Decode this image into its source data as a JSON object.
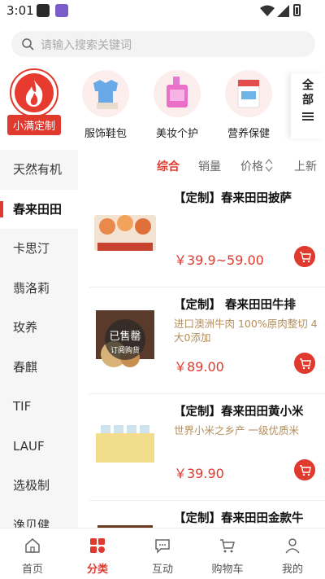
{
  "status_bar": {
    "time": "3:01"
  },
  "search": {
    "placeholder": "请输入搜索关键词"
  },
  "categories": [
    {
      "label": "小满定制",
      "icon": "fire-icon",
      "active": true
    },
    {
      "label": "服饰鞋包",
      "icon": "clothing-icon",
      "active": false
    },
    {
      "label": "美妆个护",
      "icon": "cosmetics-icon",
      "active": false
    },
    {
      "label": "营养保健",
      "icon": "nutrition-icon",
      "active": false
    }
  ],
  "all_categories": {
    "label": "全部"
  },
  "sidebar": {
    "items": [
      {
        "label": "天然有机"
      },
      {
        "label": "春来田田"
      },
      {
        "label": "卡思汀"
      },
      {
        "label": "翡洛莉"
      },
      {
        "label": "玫养"
      },
      {
        "label": "春麒"
      },
      {
        "label": "TIF"
      },
      {
        "label": "LAUF"
      },
      {
        "label": "选极制"
      },
      {
        "label": "逸贝健"
      }
    ],
    "active_index": 1
  },
  "sort": {
    "comprehensive": "综合",
    "sales": "销量",
    "price": "价格",
    "new": "上新"
  },
  "products": [
    {
      "title": "【定制】春来田田披萨",
      "desc": "",
      "price": "￥39.9~59.00",
      "sold_out": false
    },
    {
      "title": "【定制】 春来田田牛排",
      "desc": "进口澳洲牛肉 100%原肉整切 4大0添加",
      "price": "￥89.00",
      "sold_out": true,
      "sold_out_text": "已售罄",
      "sold_out_sub": "订阅购货"
    },
    {
      "title": "【定制】春来田田黄小米",
      "desc": "世界小米之乡产 一级优质米",
      "price": "￥39.90",
      "sold_out": false
    },
    {
      "title": "【定制】春来田田金款牛",
      "desc": "",
      "price": "",
      "sold_out": false
    }
  ],
  "tabbar": [
    {
      "label": "首页",
      "icon": "home-icon",
      "active": false
    },
    {
      "label": "分类",
      "icon": "category-icon",
      "active": true
    },
    {
      "label": "互动",
      "icon": "chat-icon",
      "active": false
    },
    {
      "label": "购物车",
      "icon": "cart-icon",
      "active": false
    },
    {
      "label": "我的",
      "icon": "user-icon",
      "active": false
    }
  ],
  "colors": {
    "accent": "#e03a2f",
    "desc": "#b58d5a"
  }
}
